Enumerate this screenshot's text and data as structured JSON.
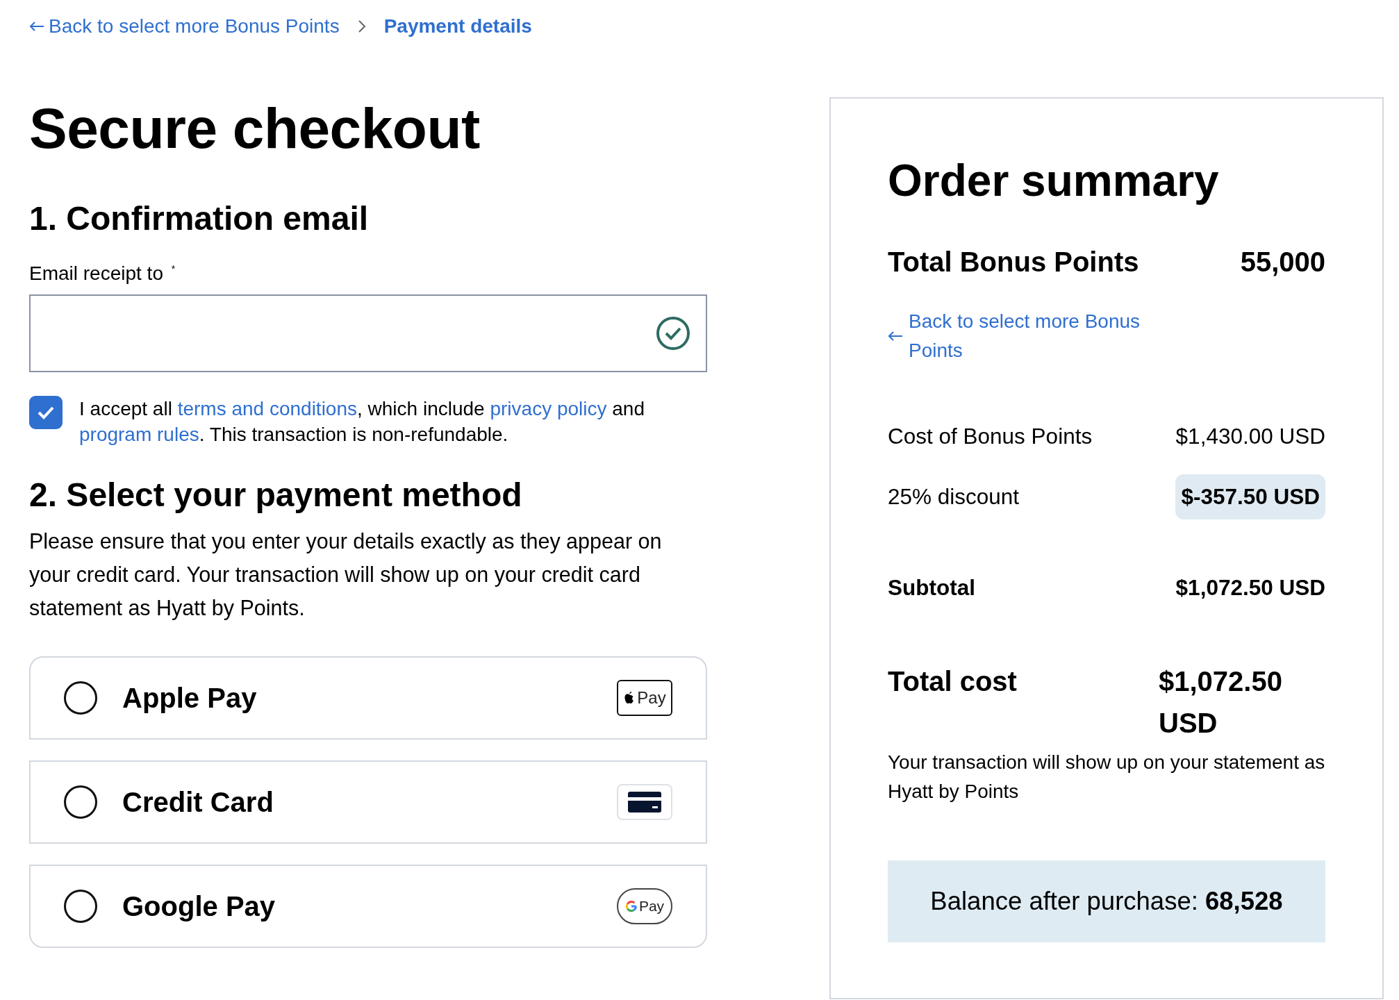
{
  "breadcrumb": [
    {
      "label": "Back to select more Bonus Points",
      "current": false
    },
    {
      "label": "Payment details",
      "current": true
    }
  ],
  "title": "Secure checkout",
  "email_section": {
    "heading": "1. Confirmation email",
    "label": "Email receipt to $^{*}$",
    "valid": true,
    "consent": {
      "checked": true,
      "parts": [
        {
          "text": "I accept all ",
          "link": false
        },
        {
          "text": "terms and conditions",
          "link": true
        },
        {
          "text": ", which include ",
          "link": false
        },
        {
          "text": "privacy policy",
          "link": true
        },
        {
          "text": " and ",
          "link": false
        },
        {
          "text": "program rules",
          "link": true
        },
        {
          "text": ". This transaction is non-refundable.",
          "link": false
        }
      ]
    }
  },
  "payment_section": {
    "heading": "2. Select your payment method",
    "note": "Please ensure that you enter your details exactly as they appear on your credit card. Your transaction will show up on your credit card statement as Hyatt by Points.",
    "methods": [
      {
        "label": "Apple Pay",
        "kind": "apple",
        "logo_text": "Pay",
        "selected": false
      },
      {
        "label": "Credit Card",
        "kind": "card",
        "selected": false
      },
      {
        "label": "Google Pay",
        "kind": "google",
        "logo_text": "Pay",
        "selected": false
      }
    ]
  },
  "order_summary": {
    "title": "Order summary",
    "total_points": {
      "label": "Total Bonus Points",
      "value": "55,000"
    },
    "back_link": "Back to select more Bonus Points",
    "rows": [
      {
        "label": "Cost of Bonus Points",
        "value": "$1,430.00 USD",
        "kind": "plain"
      },
      {
        "label": "25% discount",
        "value": "$-357.50 USD",
        "kind": "highlight"
      },
      {
        "label": "Subtotal",
        "value": "$1,072.50 USD",
        "kind": "bold"
      }
    ],
    "total": {
      "label": "Total cost",
      "value": "$1,072.50 USD"
    },
    "note": "Your transaction will show up on your statement as Hyatt by Points",
    "balance": "Balance after purchase: **68,528**"
  }
}
